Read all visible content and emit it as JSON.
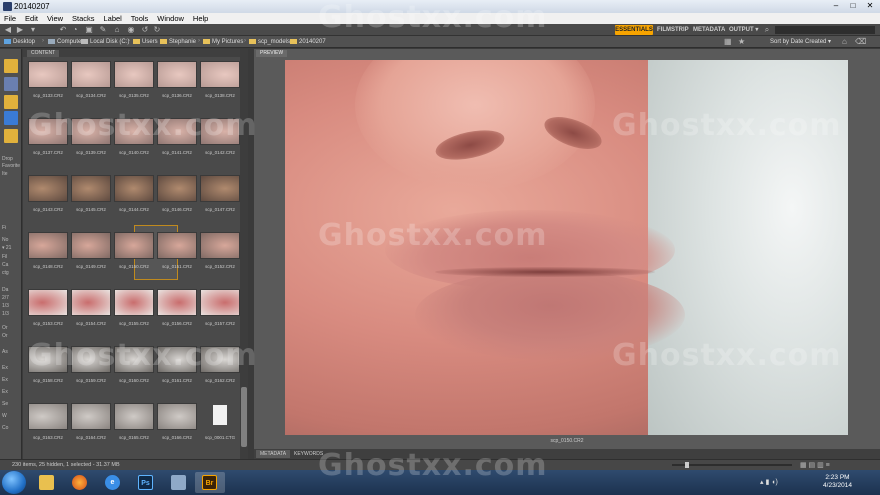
{
  "window": {
    "title": "20140207",
    "controls": [
      "–",
      "□",
      "✕"
    ]
  },
  "menu": [
    "File",
    "Edit",
    "View",
    "Stacks",
    "Label",
    "Tools",
    "Window",
    "Help"
  ],
  "workspaces": {
    "essentials": "ESSENTIALS",
    "filmstrip": "FILMSTRIP",
    "metadata": "METADATA",
    "output": "OUTPUT ▾"
  },
  "breadcrumb": [
    "Desktop",
    "Computer",
    "Local Disk (C:)",
    "Users",
    "Stephanie",
    "My Pictures",
    "scp_models",
    "20140207"
  ],
  "sort": {
    "label": "Sort by Date Created ▾"
  },
  "left_panel": {
    "items": [
      "Drop",
      "Favorite",
      "Ite",
      "Fi",
      "No",
      "▾ 21",
      "Fil",
      "Ca",
      "ctg",
      "Da",
      "2/7",
      "1/3",
      "1/3",
      "Or",
      "Or",
      "As",
      "Ex",
      "Ex",
      "Ex",
      "Se",
      "W",
      "Co"
    ]
  },
  "content_panel": {
    "tab": "CONTENT",
    "thumb_labels": [
      [
        "scp_0133.CR2",
        "scp_0134.CR2",
        "scp_0135.CR2",
        "scp_0136.CR2",
        "scp_0138.CR2"
      ],
      [
        "scp_0137.CR2",
        "scp_0139.CR2",
        "scp_0140.CR2",
        "scp_0141.CR2",
        "scp_0142.CR2"
      ],
      [
        "scp_0143.CR2",
        "scp_0145.CR2",
        "scp_0144.CR2",
        "scp_0146.CR2",
        "scp_0147.CR2"
      ],
      [
        "scp_0148.CR2",
        "scp_0149.CR2",
        "scp_0150.CR2",
        "scp_0151.CR2",
        "scp_0152.CR2"
      ],
      [
        "scp_0153.CR2",
        "scp_0154.CR2",
        "scp_0155.CR2",
        "scp_0156.CR2",
        "scp_0157.CR2"
      ],
      [
        "scp_0158.CR2",
        "scp_0159.CR2",
        "scp_0160.CR2",
        "scp_0161.CR2",
        "scp_0162.CR2"
      ],
      [
        "scp_0163.CR2",
        "scp_0164.CR2",
        "scp_0165.CR2",
        "scp_0166.CR2",
        "scp_0001.CTG"
      ]
    ]
  },
  "preview": {
    "tab": "PREVIEW",
    "filename": "scp_0150.CR2"
  },
  "bottom_tabs": [
    "METADATA",
    "KEYWORDS"
  ],
  "status": {
    "text": "230 items, 25 hidden, 1 selected - 31.37 MB"
  },
  "taskbar": {
    "apps": [
      "Explorer",
      "Firefox",
      "Internet Explorer",
      "Ps",
      "Bridge",
      "Br"
    ],
    "time": "2:23 PM",
    "date": "4/23/2014"
  },
  "watermark": "Ghostxx.com"
}
